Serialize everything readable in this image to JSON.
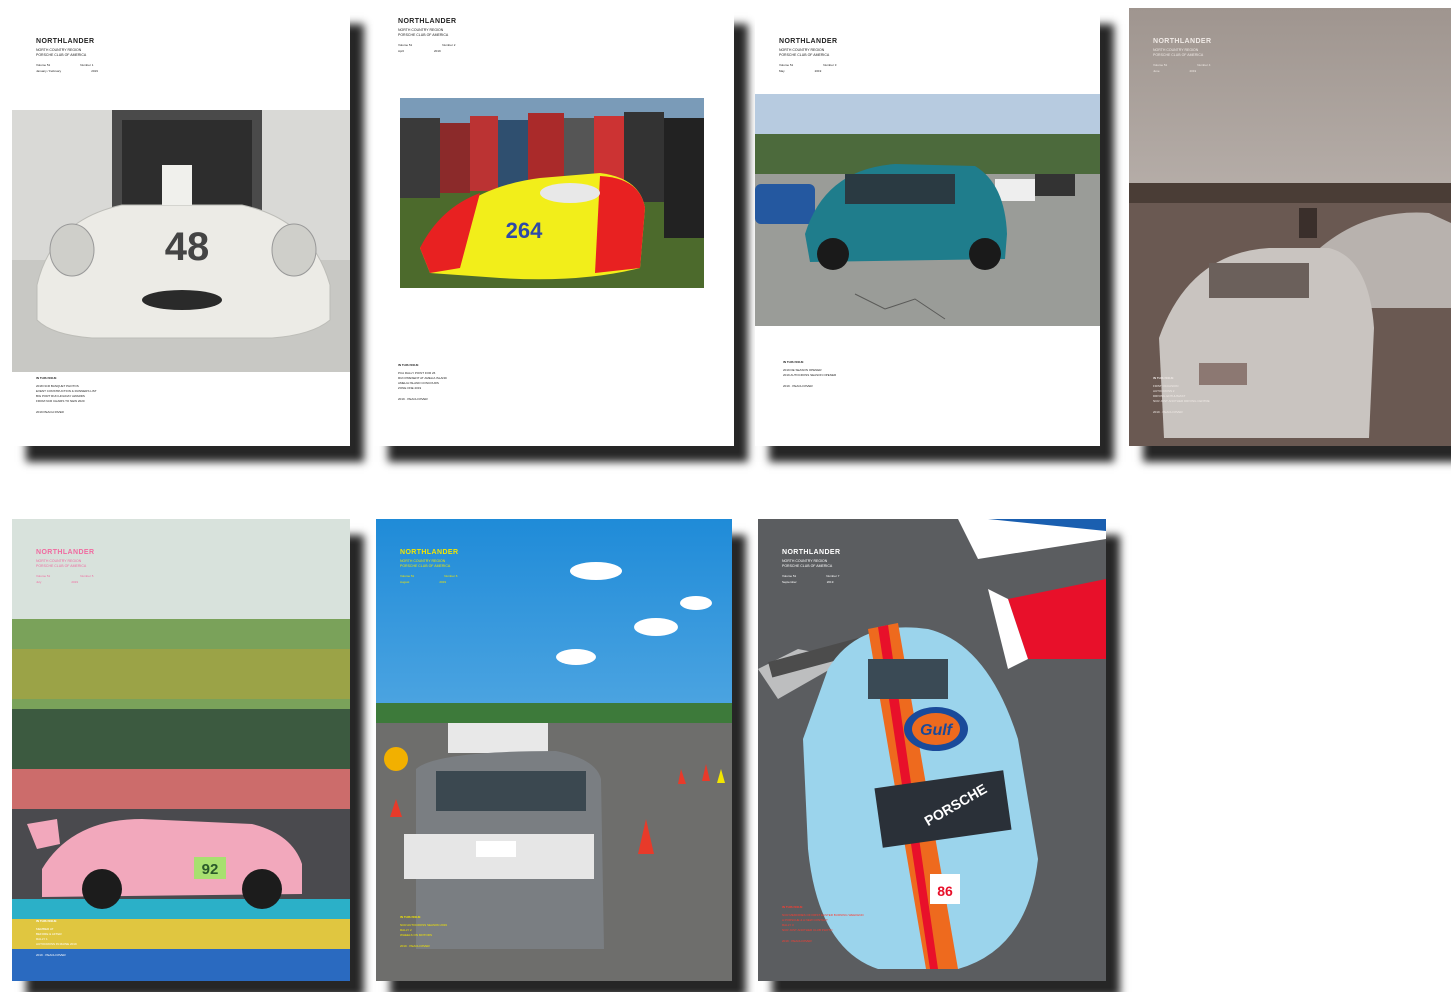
{
  "covers": [
    {
      "masthead": "NORTHLANDER",
      "region": "NORTH COUNTRY REGION",
      "club": "PORSCHE CLUB OF AMERICA",
      "volume": "Volume 51",
      "number": "Number 1",
      "month": "January / February",
      "year": "2019",
      "toc_heading": "IN THIS ISSUE",
      "toc": [
        "2018 NCR BANQUET PHOTOS",
        "EVENT CONSTRUCTION & RUNNERS LIST",
        "BIG PORT RUN HOLIDAY AWARDS",
        "FROM NCR CHAIRS TO NEW 2020"
      ],
      "footer": "2019 PEACH RIVER",
      "car_number": "48"
    },
    {
      "masthead": "NORTHLANDER",
      "region": "NORTH COUNTRY REGION",
      "club": "PORSCHE CLUB OF AMERICA",
      "volume": "Volume 51",
      "number": "Number 2",
      "month": "April",
      "year": "2019",
      "toc_heading": "IN THIS ISSUE",
      "toc": [
        "PCA RALLY POINT FOR 26",
        "RUN PRESENT AT AMELIA ISLAND",
        "AMELIA ISLAND CONCOURS",
        "ZONE ONE 2019"
      ],
      "footer": "2019 · PEACH RIVER",
      "car_number": "264"
    },
    {
      "masthead": "NORTHLANDER",
      "region": "NORTH COUNTRY REGION",
      "club": "PORSCHE CLUB OF AMERICA",
      "volume": "Volume 51",
      "number": "Number 3",
      "month": "May",
      "year": "2019",
      "toc_heading": "IN THIS ISSUE",
      "toc": [
        "2019 DE SEASON OPENER",
        "2019 AUTOCROSS SEASON OPENER"
      ],
      "footer": "2019 · PEACH RIVER",
      "car_number": ""
    },
    {
      "masthead": "NORTHLANDER",
      "region": "NORTH COUNTRY REGION",
      "club": "PORSCHE CLUB OF AMERICA",
      "volume": "Volume 51",
      "number": "Number 4",
      "month": "June",
      "year": "2019",
      "toc_heading": "IN THIS ISSUE",
      "toc": [
        "FIRST OCCASION",
        "AUTOCROSS 2",
        "DRIVING ENTHUSIAST",
        "NCR JUST ANOTHER DRIVING CENTRE"
      ],
      "footer": "2019 · PEACH RIVER",
      "car_number": ""
    },
    {
      "masthead": "NORTHLANDER",
      "region": "NORTH COUNTRY REGION",
      "club": "PORSCHE CLUB OF AMERICA",
      "volume": "Volume 51",
      "number": "Number 5",
      "month": "July",
      "year": "2019",
      "toc_heading": "IN THIS ISSUE",
      "toc": [
        "MEMBER AT",
        "BEFORE & AFTER",
        "RALLY 1",
        "AUTOCROSS IN MAINE 2019"
      ],
      "footer": "2019 · PEACH RIVER",
      "car_number": "92"
    },
    {
      "masthead": "NORTHLANDER",
      "region": "NORTH COUNTRY REGION",
      "club": "PORSCHE CLUB OF AMERICA",
      "volume": "Volume 51",
      "number": "Number 6",
      "month": "August",
      "year": "2019",
      "toc_heading": "IN THIS ISSUE",
      "toc": [
        "NCR AUTOCROSS SEASON 2019",
        "RALLY 2",
        "WHEELS ON MOTORS"
      ],
      "footer": "2019 · PEACH RIVER",
      "car_number": ""
    },
    {
      "masthead": "NORTHLANDER",
      "region": "NORTH COUNTRY REGION",
      "club": "PORSCHE CLUB OF AMERICA",
      "volume": "Volume 51",
      "number": "Number 7",
      "month": "September",
      "year": "2019",
      "toc_heading": "IN THIS ISSUE",
      "toc": [
        "NCR MEMORIES OF FIRST EASTER BURNING WEEKEND",
        "A PORSCHE & A NEW CONTACT",
        "RALLY 3",
        "NCR JUST ANOTHER CLUB PHOTO"
      ],
      "footer": "2019 · PEACH RIVER",
      "car_number": "86",
      "brand_text": "Gulf",
      "side_text": "PORSCHE"
    }
  ],
  "colors": {
    "shadow": "#000000",
    "cover1_text": "#222222",
    "cover4_text": "#f0eae6",
    "cover5_text": "#f06ba0",
    "cover6_text": "#f2e600",
    "cover7_text": "#ffffff",
    "cover7_toc": "#ff3b2f"
  }
}
